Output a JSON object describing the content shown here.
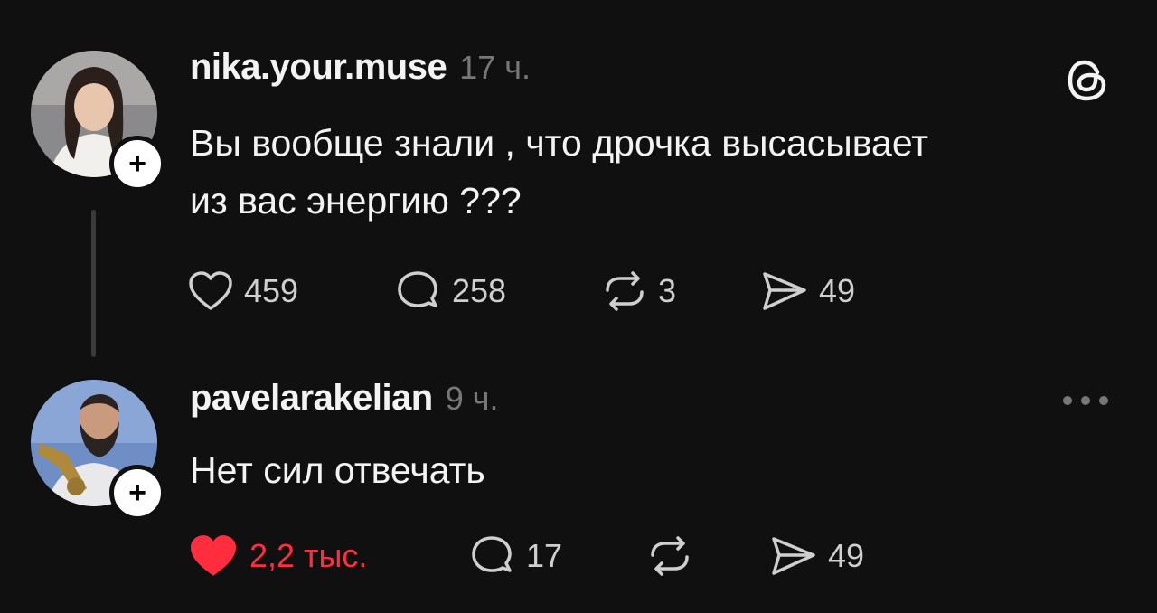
{
  "posts": [
    {
      "username": "nika.your.muse",
      "time": "17 ч.",
      "text": "Вы вообще знали , что дрочка высасывает\nиз вас энергию ???",
      "likes": "459",
      "comments": "258",
      "reposts": "3",
      "shares": "49",
      "liked": false
    },
    {
      "username": "pavelarakelian",
      "time": "9 ч.",
      "text": "Нет сил отвечать",
      "likes": "2,2 тыс.",
      "comments": "17",
      "reposts": "",
      "shares": "49",
      "liked": true
    }
  ],
  "icons": {
    "follow": "plus-icon",
    "app": "threads-logo-icon",
    "more": "more-dots-icon",
    "like": "heart-icon",
    "comment": "comment-bubble-icon",
    "repost": "repost-icon",
    "share": "send-icon"
  },
  "follow_symbol": "+",
  "colors": {
    "background": "#101010",
    "text": "#f3f3f3",
    "muted": "#777777",
    "like_active": "#ff2d3d"
  }
}
